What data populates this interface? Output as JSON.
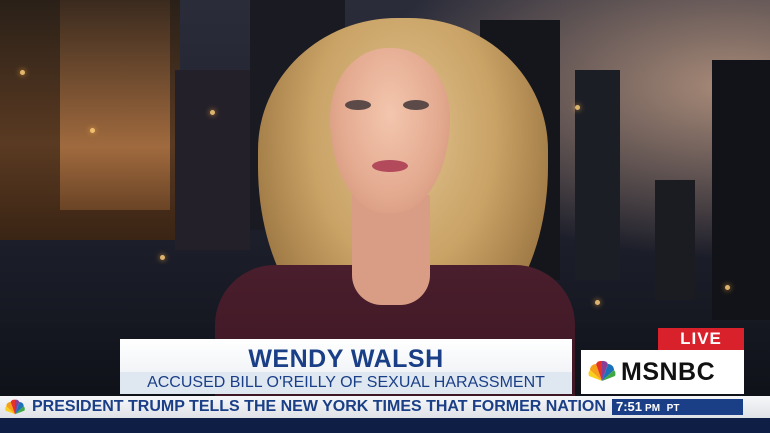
{
  "lower_third": {
    "name": "WENDY WALSH",
    "subtitle": "ACCUSED BILL O'REILLY OF SEXUAL HARASSMENT"
  },
  "network": {
    "live_label": "LIVE",
    "name": "MSNBC",
    "logo_icon": "peacock-icon"
  },
  "ticker": {
    "headline": "PRESIDENT TRUMP TELLS THE NEW YORK TIMES THAT FORMER NATION",
    "time": "7:51",
    "time_suffix": "PM",
    "timezone": "PT"
  },
  "colors": {
    "accent_blue": "#1b3f86",
    "live_red": "#d9212b"
  }
}
